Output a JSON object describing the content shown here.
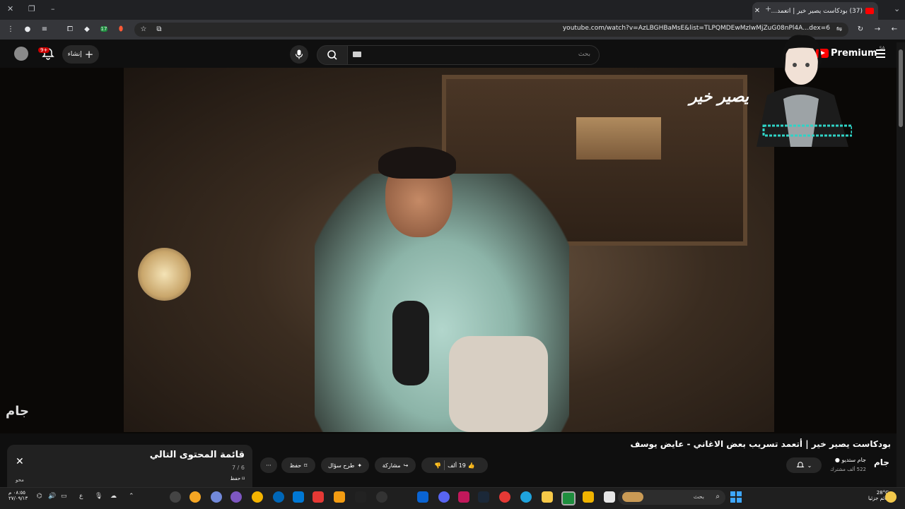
{
  "browser": {
    "tab_title": "(37) بودكاست يصير خير | أتعمد...",
    "tab_close": "✕",
    "new_tab": "+",
    "url": "youtube.com/watch?v=AzLBGHBaMsE&list=TLPQMDEwMzIwMjZuG08nPl4A…dex=6",
    "ext_badge": "17"
  },
  "youtube": {
    "logo_text": "Premium",
    "region": "SA",
    "search_placeholder": "بحث",
    "create_label": "إنشاء",
    "notif_badge": "9+"
  },
  "video": {
    "watermark": "يصير خير",
    "corner_logo": "جام"
  },
  "details": {
    "title": "بودكاست يصير خير | أتعمد تسريب بعض الاغاني - عايض يوسف",
    "channel_name": "جام ستديو",
    "subscribers": "522 ألف مشترك",
    "channel_icon": "جام",
    "likes": "19 ألف",
    "share_label": "مشاركة",
    "ask_label": "طرح سؤال",
    "save_label": "حفظ",
    "more_label": "···"
  },
  "playlist": {
    "title": "قائمة المحتوى التالي",
    "count": "7 / 6",
    "save": "حفظ",
    "edit": "محو"
  },
  "taskbar": {
    "search_text": "بحث",
    "weather_temp": "28°C",
    "weather_desc": "غائم جزئيا",
    "time": "٠٨:٥٥ م",
    "date": "٢٧/٠٩/١٣",
    "lang": "ع"
  },
  "colors": {
    "accent_red": "#ff0000",
    "background": "#0f0f0f"
  }
}
